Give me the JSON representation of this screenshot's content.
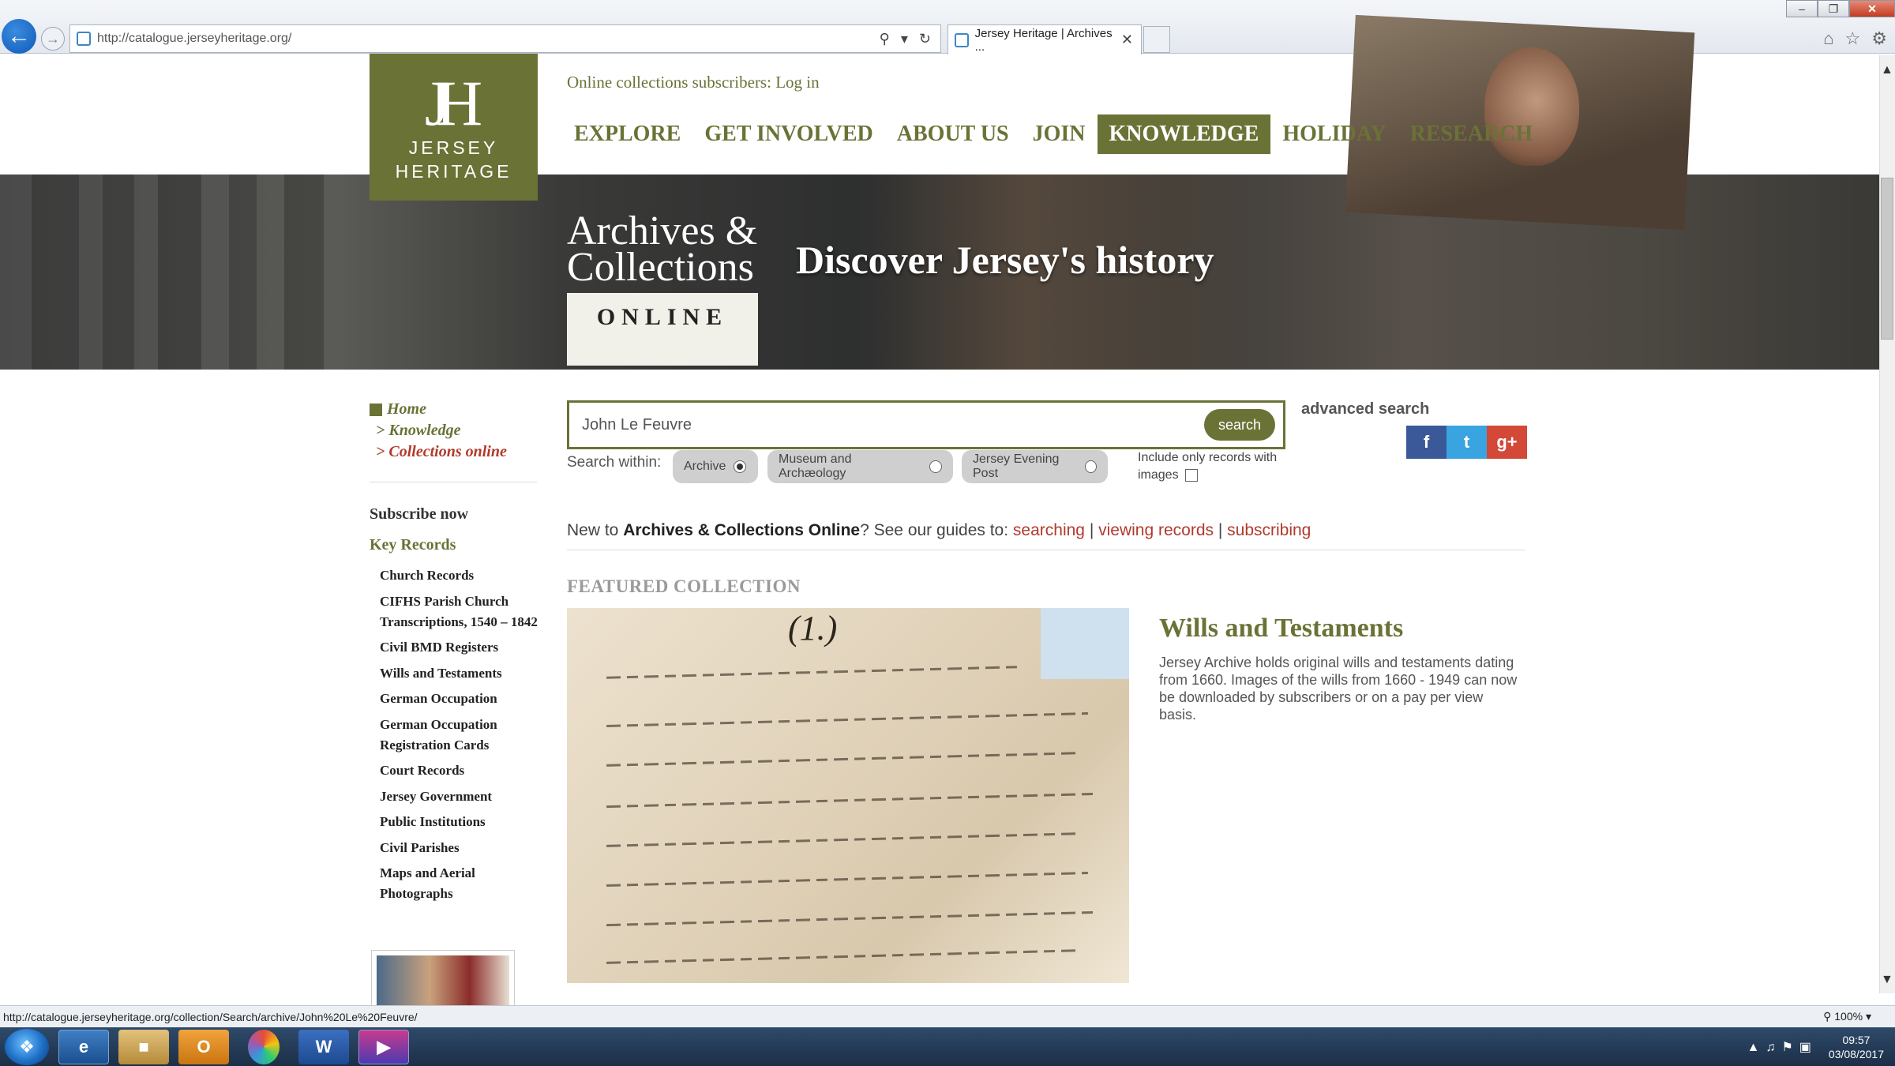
{
  "browser": {
    "url": "http://catalogue.jerseyheritage.org/",
    "tab_title": "Jersey Heritage | Archives ...",
    "status_url": "http://catalogue.jerseyheritage.org/collection/Search/archive/John%20Le%20Feuvre/",
    "zoom": "100%"
  },
  "header": {
    "logo_mono": "JH",
    "logo_word1": "JERSEY",
    "logo_word2": "HERITAGE",
    "login_text": "Online collections subscribers: Log in",
    "nav": [
      "EXPLORE",
      "GET INVOLVED",
      "ABOUT US",
      "JOIN",
      "KNOWLEDGE",
      "HOLIDAY",
      "RESEARCH"
    ],
    "active_nav": "KNOWLEDGE"
  },
  "hero": {
    "brand_line1": "Archives &",
    "brand_line2": "Collections",
    "banner": "ONLINE",
    "tagline": "Discover Jersey's history"
  },
  "sidebar": {
    "breadcrumb": [
      "Home",
      "> Knowledge",
      "> Collections online"
    ],
    "subscribe_now": "Subscribe now",
    "key_records_heading": "Key Records",
    "key_records": [
      "Church Records",
      "CIFHS Parish Church Transcriptions, 1540 – 1842",
      "Civil BMD Registers",
      "Wills and Testaments",
      "German Occupation",
      "German Occupation Registration Cards",
      "Court Records",
      "Jersey Government",
      "Public Institutions",
      "Civil Parishes",
      "Maps and Aerial Photographs"
    ]
  },
  "search": {
    "value": "John Le Feuvre",
    "button": "search",
    "advanced": "advanced search",
    "within_label": "Search within:",
    "options": [
      "Archive",
      "Museum and Archæology",
      "Jersey Evening Post"
    ],
    "selected": "Archive",
    "images_only": "Include only records with images"
  },
  "guides": {
    "prefix": "New to ",
    "brand": "Archives & Collections Online",
    "middle": "? See our guides to: ",
    "links": [
      "searching",
      "viewing records",
      "subscribing"
    ],
    "sep": " | "
  },
  "featured": {
    "label": "FEATURED COLLECTION",
    "title": "Wills and Testaments",
    "description": "Jersey Archive holds original wills and testaments dating from 1660. Images of the wills from 1660 - 1949 can now be downloaded by subscribers or on a pay per view basis.",
    "ms_number": "(1.)"
  },
  "social": {
    "facebook": "f",
    "twitter": "t",
    "gplus": "g+"
  },
  "taskbar": {
    "time": "09:57",
    "date": "03/08/2017",
    "word_label": "W"
  },
  "colors": {
    "olive": "#6b7236",
    "link_red": "#b13a2c"
  }
}
